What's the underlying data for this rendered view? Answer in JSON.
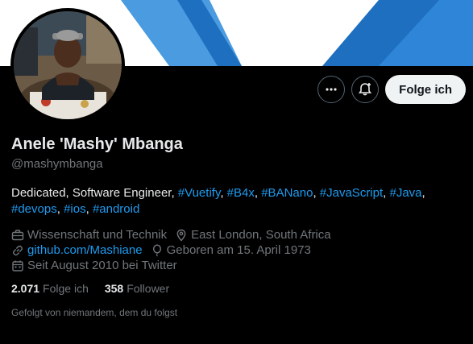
{
  "profile": {
    "display_name": "Anele 'Mashy' Mbanga",
    "handle": "@mashymbanga",
    "bio": {
      "text": "Dedicated, Software Engineer, ",
      "tags": [
        {
          "label": "#Vuetify",
          "sep": ", "
        },
        {
          "label": "#B4x",
          "sep": ", "
        },
        {
          "label": "#BANano",
          "sep": ", "
        },
        {
          "label": "#JavaScript",
          "sep": ", "
        },
        {
          "label": "#Java",
          "sep": ","
        },
        {
          "label": "#devops",
          "sep": ", "
        },
        {
          "label": "#ios",
          "sep": ", "
        },
        {
          "label": "#android",
          "sep": ""
        }
      ]
    },
    "meta": {
      "category": "Wissenschaft und Technik",
      "location": "East London, South Africa",
      "website": "github.com/Mashiane",
      "birthday": "Geboren am 15. April 1973",
      "joined": "Seit August 2010 bei Twitter"
    },
    "stats": {
      "following_count": "2.071",
      "following_label": "Folge ich",
      "followers_count": "358",
      "followers_label": "Follower"
    },
    "followed_by": "Gefolgt von niemandem, dem du folgst"
  },
  "actions": {
    "more_icon": "more-icon",
    "notify_icon": "bell-plus-icon",
    "follow_label": "Folge ich"
  },
  "colors": {
    "background": "#000000",
    "text": "#e7e9ea",
    "muted": "#71767b",
    "link": "#1d9bf0",
    "banner_blue": "#2f86d8"
  }
}
